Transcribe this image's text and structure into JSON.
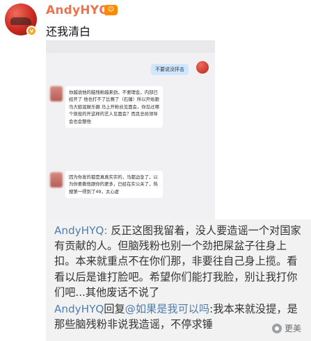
{
  "post": {
    "username": "AndyHYQ",
    "badge_icon": "vip-level-icon",
    "text": "还我清白"
  },
  "screenshot": {
    "my_bubble": "不要说没抨击",
    "bubble1": "你越说他的脑残粉越来劲，不要理会，内部已经开了 他也打不了比赛了（石锤）所以开始跟马大姐混娱乐圈 马上开粉丝见面会，你见过哪个现役的开这样的艺人见面会？而且总局领导会也会整他",
    "bubble2": "因为你发的都是真真实实的，马都边急了，以为你要撕他跟你的更多，已经在实公关了，热搜第一得到了49，太心虚"
  },
  "comments": [
    {
      "name": "AndyHYQ:",
      "text": " 反正这图我留着，没人要造谣一个对国家有贡献的人。但脑残粉也别一个劲把屎盆子往身上扣。本来就重点不在你们那，非要往自己身上揽。看看以后是谁打脸吧。希望你们能打我脸，别让我打你们吧...其他废话不说了"
    },
    {
      "name": "AndyHYQ",
      "reply_word": "回复",
      "reply_to": "@如果是我可以吗",
      "text": ":我本来就没提，是那些脑残粉非说我造谣，不停求锤"
    }
  ],
  "watermark": {
    "icon": "wechat-channel-icon",
    "text": "更美"
  }
}
